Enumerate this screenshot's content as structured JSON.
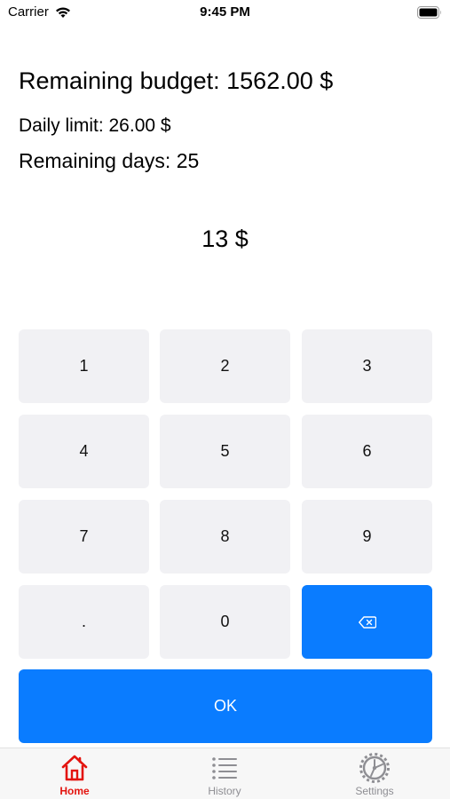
{
  "status_bar": {
    "carrier": "Carrier",
    "time": "9:45 PM",
    "wifi_icon": "wifi-icon",
    "battery_icon": "battery-icon"
  },
  "budget": {
    "remaining_budget": "Remaining budget: 1562.00 $",
    "daily_limit": "Daily limit: 26.00 $",
    "remaining_days": "Remaining days: 25"
  },
  "amount": "13 $",
  "keypad": {
    "keys": [
      "1",
      "2",
      "3",
      "4",
      "5",
      "6",
      "7",
      "8",
      "9",
      ".",
      "0"
    ],
    "backspace_icon": "backspace-icon",
    "ok_label": "OK"
  },
  "tabs": [
    {
      "label": "Home",
      "icon": "home-icon",
      "active": true
    },
    {
      "label": "History",
      "icon": "list-icon",
      "active": false
    },
    {
      "label": "Settings",
      "icon": "gear-icon",
      "active": false
    }
  ],
  "colors": {
    "accent_blue": "#0a7cff",
    "active_tab": "#e3140f",
    "key_background": "#f1f1f4"
  }
}
